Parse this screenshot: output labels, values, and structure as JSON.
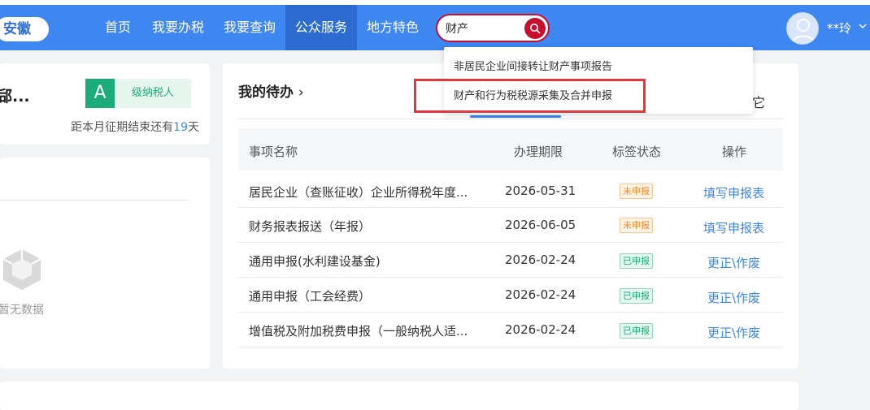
{
  "header": {
    "region": "安徽",
    "nav": [
      "首页",
      "我要办税",
      "我要查询",
      "公众服务",
      "地方特色"
    ],
    "active_nav": "公众服务",
    "search_value": "财产",
    "username": "**玲"
  },
  "dropdown": {
    "items": [
      "非居民企业间接转让财产事项报告",
      "财产和行为税税源采集及合并申报"
    ]
  },
  "company_card": {
    "company_name": "郈...",
    "grade": "A",
    "grade_label": "级纳税人",
    "deadline_prefix": "距本月征期结束还有",
    "deadline_days": "19",
    "deadline_suffix": "天"
  },
  "empty_card": {
    "text": "暂无数据"
  },
  "todo": {
    "title": "我的待办",
    "tab_other": "它",
    "columns": [
      "事项名称",
      "办理期限",
      "标签状态",
      "操作"
    ],
    "rows": [
      {
        "name": "居民企业（查账征收）企业所得税年度...",
        "deadline": "2026-05-31",
        "status": "未申报",
        "action": "填写申报表"
      },
      {
        "name": "财务报表报送（年报）",
        "deadline": "2026-06-05",
        "status": "未申报",
        "action": "填写申报表"
      },
      {
        "name": "通用申报(水利建设基金)",
        "deadline": "2026-02-24",
        "status": "已申报",
        "action": "更正\\作废"
      },
      {
        "name": "通用申报（工会经费）",
        "deadline": "2026-02-24",
        "status": "已申报",
        "action": "更正\\作废"
      },
      {
        "name": "增值税及附加税费申报（一般纳税人适...",
        "deadline": "2026-02-24",
        "status": "已申报",
        "action": "更正\\作废"
      }
    ]
  },
  "colors": {
    "nav_bg": "#3e86f0",
    "nav_active": "#2c6cd0",
    "search_border": "#c8102e",
    "highlight": "#e2373b",
    "link": "#3e86f0",
    "green": "#1aad7a",
    "orange": "#f08a24"
  }
}
